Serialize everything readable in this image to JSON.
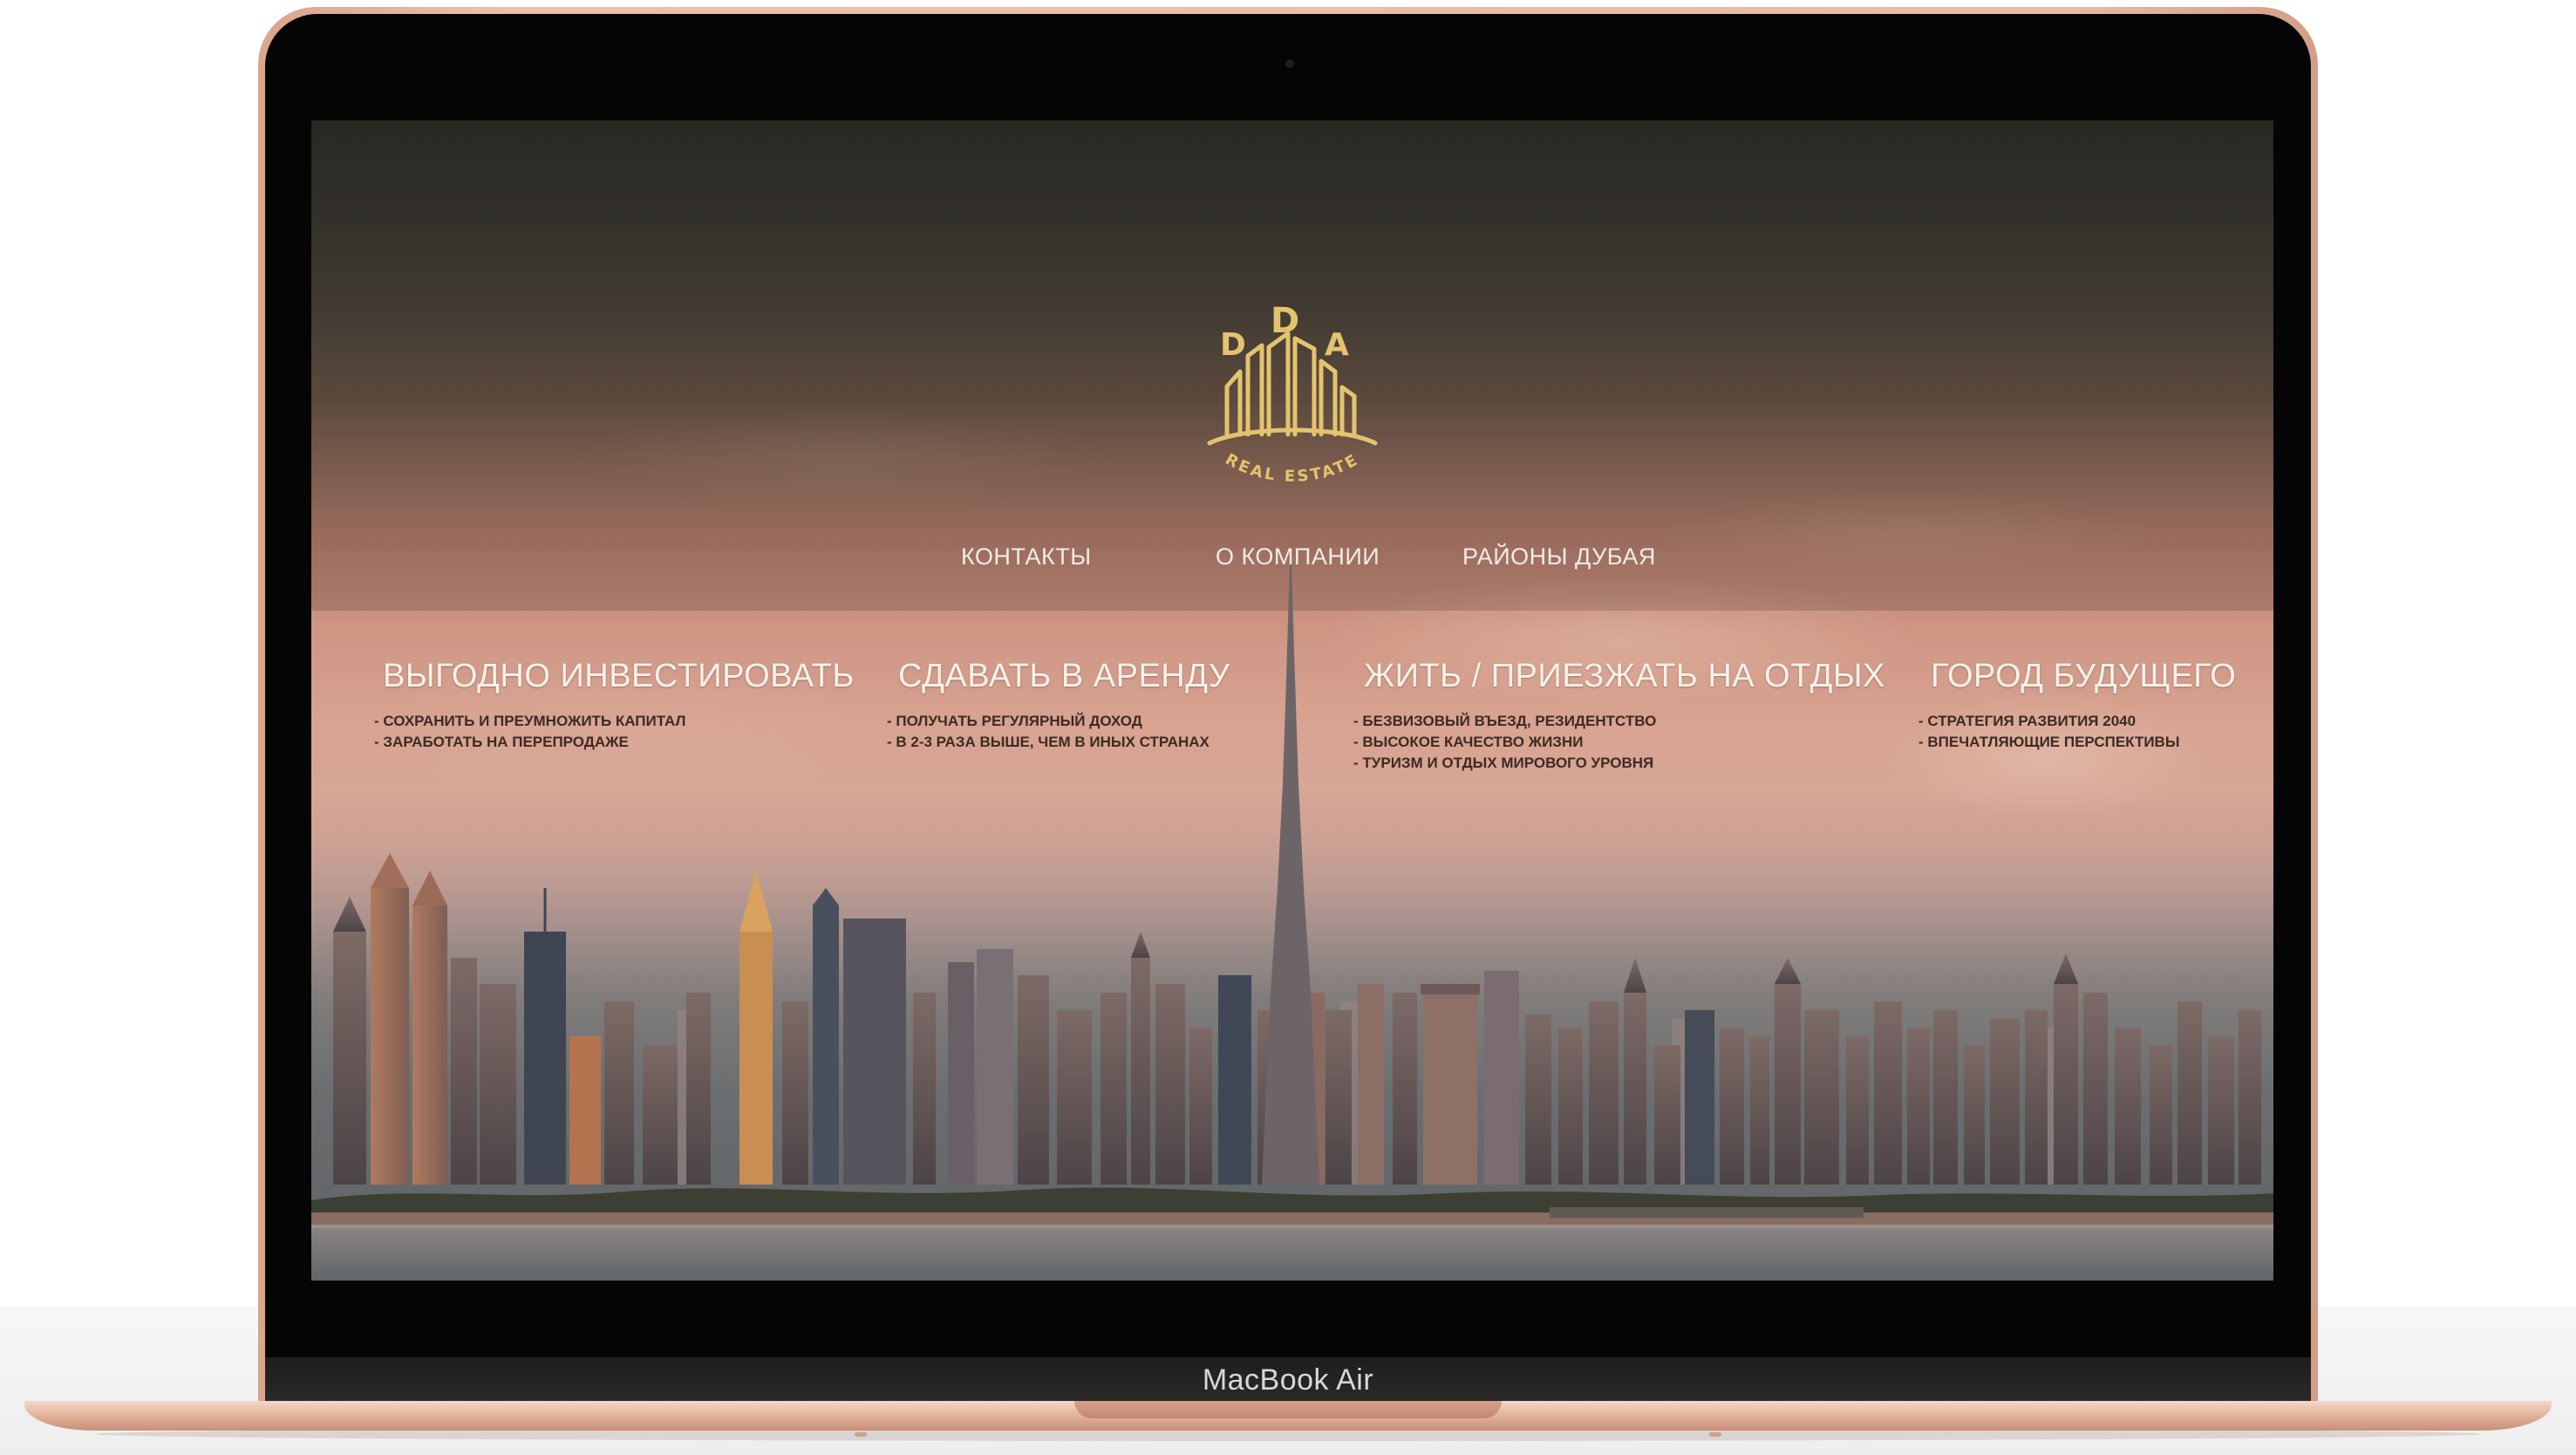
{
  "device": {
    "model_label": "MacBook Air"
  },
  "site": {
    "logo": {
      "letters": [
        "D",
        "D",
        "A"
      ],
      "tagline": "REAL ESTATE",
      "icon": "city-buildings-logo-icon",
      "color": "#e3c46e"
    },
    "nav": [
      {
        "label": "КОНТАКТЫ"
      },
      {
        "label": "О КОМПАНИИ"
      },
      {
        "label": "РАЙОНЫ ДУБАЯ"
      }
    ],
    "features": [
      {
        "title": "ВЫГОДНО ИНВЕСТИРОВАТЬ",
        "points": [
          "СОХРАНИТЬ И ПРЕУМНОЖИТЬ КАПИТАЛ",
          "ЗАРАБОТАТЬ НА ПЕРЕПРОДАЖЕ"
        ]
      },
      {
        "title": "СДАВАТЬ В АРЕНДУ",
        "points": [
          "ПОЛУЧАТЬ РЕГУЛЯРНЫЙ ДОХОД",
          "В 2-3 РАЗА ВЫШЕ, ЧЕМ В ИНЫХ СТРАНАХ"
        ]
      },
      {
        "title": "ЖИТЬ / ПРИЕЗЖАТЬ НА ОТДЫХ",
        "points": [
          "БЕЗВИЗОВЫЙ ВЪЕЗД, РЕЗИДЕНТСТВО",
          "ВЫСОКОЕ КАЧЕСТВО ЖИЗНИ",
          "ТУРИЗМ И ОТДЫХ МИРОВОГО УРОВНЯ"
        ]
      },
      {
        "title": "ГОРОД БУДУЩЕГО",
        "points": [
          "СТРАТЕГИЯ РАЗВИТИЯ 2040",
          "ВПЕЧАТЛЯЮЩИЕ ПЕРСПЕКТИВЫ"
        ]
      }
    ],
    "hero_image": "dubai-skyline-photo"
  }
}
